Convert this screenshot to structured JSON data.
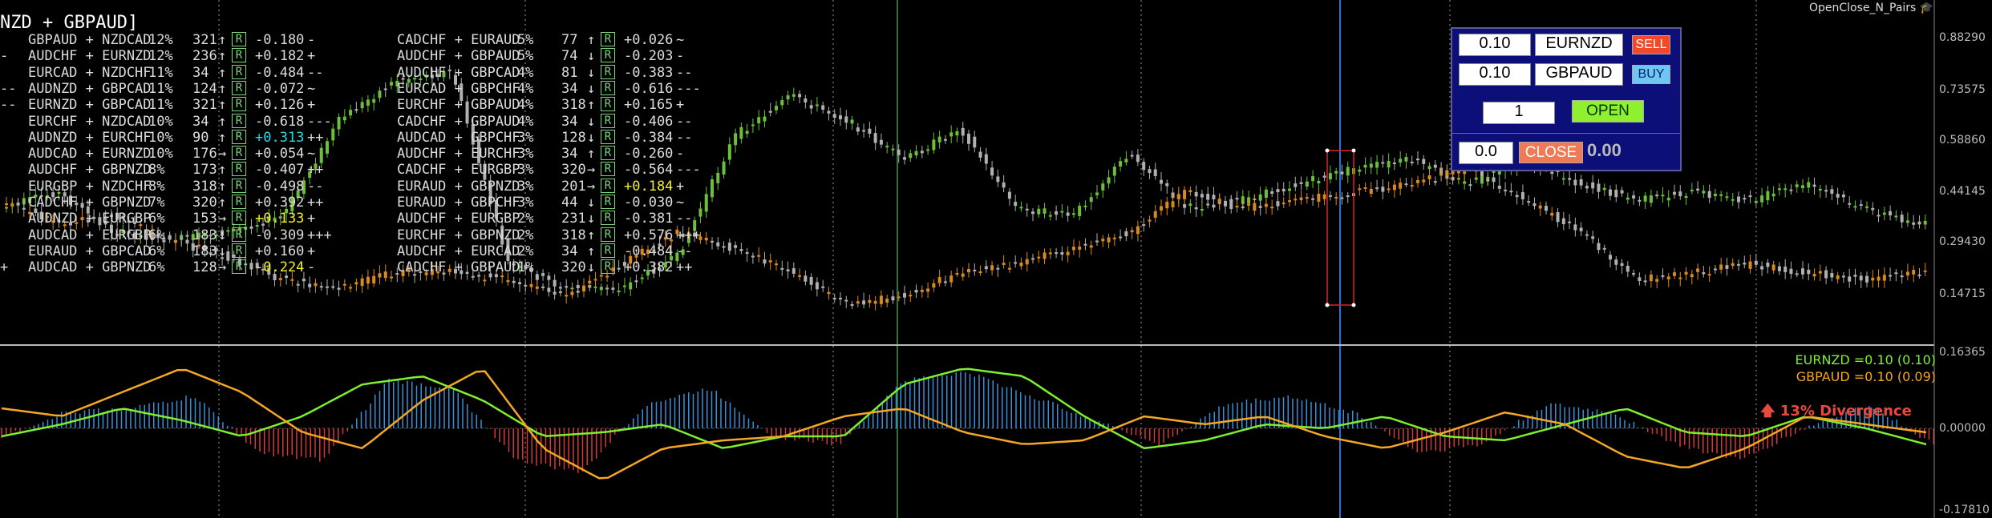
{
  "title": "NZD + GBPAUD]",
  "brand": "OpenClose_N_Pairs",
  "price_axis": [
    "0.88290",
    "0.73575",
    "0.58860",
    "0.44145",
    "0.29430",
    "0.14715",
    "0.16365",
    "0.00000",
    "-0.17810"
  ],
  "left_table": [
    {
      "prefix": "",
      "pair": "GBPAUD + NZDCAD",
      "pct": "12%",
      "num": "321",
      "arrow": "↑",
      "tag": "R",
      "val": "-0.180",
      "sig": "-",
      "val_color": "#dcdcdc"
    },
    {
      "prefix": "-",
      "pair": "AUDCHF + EURNZD",
      "pct": "12%",
      "num": "236",
      "arrow": "↑",
      "tag": "R",
      "val": "+0.182",
      "sig": "+",
      "val_color": "#dcdcdc"
    },
    {
      "prefix": "",
      "pair": "EURCAD + NZDCHF",
      "pct": "11%",
      "num": "34",
      "arrow": "↑",
      "tag": "R",
      "val": "-0.484",
      "sig": "--",
      "val_color": "#dcdcdc"
    },
    {
      "prefix": "--",
      "pair": "AUDNZD + GBPCAD",
      "pct": "11%",
      "num": "124",
      "arrow": "↑",
      "tag": "R",
      "val": "-0.072",
      "sig": "~",
      "val_color": "#dcdcdc"
    },
    {
      "prefix": "--",
      "pair": "EURNZD + GBPCAD",
      "pct": "11%",
      "num": "321",
      "arrow": "↑",
      "tag": "R",
      "val": "+0.126",
      "sig": "+",
      "val_color": "#dcdcdc"
    },
    {
      "prefix": "",
      "pair": "EURCHF + NZDCAD",
      "pct": "10%",
      "num": "34",
      "arrow": "↑",
      "tag": "R",
      "val": "-0.618",
      "sig": "---",
      "val_color": "#dcdcdc"
    },
    {
      "prefix": "",
      "pair": "AUDNZD + EURCHF",
      "pct": "10%",
      "num": "90",
      "arrow": "↑",
      "tag": "R",
      "val": "+0.313",
      "sig": "++",
      "val_color": "#2fd6e8"
    },
    {
      "prefix": "",
      "pair": "AUDCAD + EURNZD",
      "pct": "10%",
      "num": "176",
      "arrow": "→",
      "tag": "R",
      "val": "+0.054",
      "sig": "~",
      "val_color": "#dcdcdc"
    },
    {
      "prefix": "",
      "pair": "AUDCHF + GBPNZD",
      "pct": "8%",
      "num": "173",
      "arrow": "↑",
      "tag": "R",
      "val": "-0.407",
      "sig": "++",
      "val_color": "#dcdcdc"
    },
    {
      "prefix": "",
      "pair": "EURGBP + NZDCHF",
      "pct": "8%",
      "num": "318",
      "arrow": "↑",
      "tag": "R",
      "val": "-0.498",
      "sig": "--",
      "val_color": "#dcdcdc"
    },
    {
      "prefix": "",
      "pair": "CADCHF + GBPNZD",
      "pct": "7%",
      "num": "320",
      "arrow": "↑",
      "tag": "R",
      "val": "+0.392",
      "sig": "++",
      "val_color": "#dcdcdc"
    },
    {
      "prefix": "",
      "pair": "AUDNZD + EURGBP",
      "pct": "6%",
      "num": "153",
      "arrow": "→",
      "tag": "R",
      "val": "+0.133",
      "sig": "+",
      "val_color": "#f2ef2a"
    },
    {
      "prefix": "",
      "pair": "AUDCAD + EURGBP",
      "pct": "6%",
      "num": "183",
      "arrow": "↓",
      "tag": "R",
      "val": "-0.309",
      "sig": "+++",
      "val_color": "#dcdcdc"
    },
    {
      "prefix": "",
      "pair": "EURAUD + GBPCAD",
      "pct": "6%",
      "num": "183",
      "arrow": "↓",
      "tag": "R",
      "val": "+0.160",
      "sig": "+",
      "val_color": "#dcdcdc"
    },
    {
      "prefix": "+",
      "pair": "AUDCAD + GBPNZD",
      "pct": "6%",
      "num": "128",
      "arrow": "→",
      "tag": "R",
      "val": "-0.224",
      "sig": "-",
      "val_color": "#f2ef2a"
    }
  ],
  "right_table": [
    {
      "pair": "CADCHF + EURAUD",
      "pct": "5%",
      "num": "77",
      "arrow": "↑",
      "tag": "R",
      "val": "+0.026",
      "sig": "~",
      "val_color": "#dcdcdc"
    },
    {
      "pair": "AUDCHF + GBPAUD",
      "pct": "5%",
      "num": "74",
      "arrow": "↓",
      "tag": "R",
      "val": "-0.203",
      "sig": "-",
      "val_color": "#dcdcdc"
    },
    {
      "pair": "AUDCHF + GBPCAD",
      "pct": "4%",
      "num": "81",
      "arrow": "↓",
      "tag": "R",
      "val": "-0.383",
      "sig": "--",
      "val_color": "#dcdcdc"
    },
    {
      "pair": "EURCAD + GBPCHF",
      "pct": "4%",
      "num": "34",
      "arrow": "↓",
      "tag": "R",
      "val": "-0.616",
      "sig": "---",
      "val_color": "#dcdcdc"
    },
    {
      "pair": "EURCHF + GBPAUD",
      "pct": "4%",
      "num": "318",
      "arrow": "↑",
      "tag": "R",
      "val": "+0.165",
      "sig": "+",
      "val_color": "#dcdcdc"
    },
    {
      "pair": "CADCHF + GBPAUD",
      "pct": "4%",
      "num": "34",
      "arrow": "↓",
      "tag": "R",
      "val": "-0.406",
      "sig": "--",
      "val_color": "#dcdcdc"
    },
    {
      "pair": "AUDCAD + GBPCHF",
      "pct": "3%",
      "num": "128",
      "arrow": "↓",
      "tag": "R",
      "val": "-0.384",
      "sig": "--",
      "val_color": "#dcdcdc"
    },
    {
      "pair": "AUDCHF + EURCHF",
      "pct": "3%",
      "num": "34",
      "arrow": "↑",
      "tag": "R",
      "val": "-0.260",
      "sig": "-",
      "val_color": "#dcdcdc"
    },
    {
      "pair": "CADCHF + EURGBP",
      "pct": "3%",
      "num": "320",
      "arrow": "→",
      "tag": "R",
      "val": "-0.564",
      "sig": "---",
      "val_color": "#dcdcdc"
    },
    {
      "pair": "EURAUD + GBPNZD",
      "pct": "3%",
      "num": "201",
      "arrow": "→",
      "tag": "R",
      "val": "+0.184",
      "sig": "+",
      "val_color": "#f2ef2a"
    },
    {
      "pair": "EURAUD + GBPCHF",
      "pct": "3%",
      "num": "44",
      "arrow": "↓",
      "tag": "R",
      "val": "-0.030",
      "sig": "~",
      "val_color": "#dcdcdc"
    },
    {
      "pair": "AUDCHF + EURGBP",
      "pct": "2%",
      "num": "231",
      "arrow": "↓",
      "tag": "R",
      "val": "-0.381",
      "sig": "--",
      "val_color": "#dcdcdc"
    },
    {
      "pair": "EURCHF + GBPNZD",
      "pct": "2%",
      "num": "318",
      "arrow": "↑",
      "tag": "R",
      "val": "+0.576",
      "sig": "+++",
      "val_color": "#dcdcdc"
    },
    {
      "pair": "AUDCHF + EURCAD",
      "pct": "2%",
      "num": "34",
      "arrow": "↑",
      "tag": "R",
      "val": "-0.484",
      "sig": "--",
      "val_color": "#dcdcdc"
    },
    {
      "pair": "CADCHF + GBPAUD",
      "pct": "1%",
      "num": "320",
      "arrow": "↓",
      "tag": "R",
      "val": "+0.382",
      "sig": "++",
      "val_color": "#dcdcdc"
    }
  ],
  "panel": {
    "lot1": "0.10",
    "sym1": "EURNZD",
    "sell_label": "SELL",
    "lot2": "0.10",
    "sym2": "GBPAUD",
    "buy_label": "BUY",
    "multiplier": "1",
    "open_label": "OPEN",
    "close_value": "0.0",
    "close_label": "CLOSE",
    "pnl": "0.00"
  },
  "indicator": {
    "legend1": "EURNZD =0.10 (0.10)",
    "legend1_color": "#7cf02e",
    "legend2": "GBPAUD =0.10 (0.09)",
    "legend2_color": "#f5a623",
    "divergence": "13% Divergence"
  },
  "colors": {
    "bull": "#6bbf3a",
    "bear": "#b0b0b0",
    "orange": "#d9891e",
    "grid": "#9a9a9a"
  }
}
